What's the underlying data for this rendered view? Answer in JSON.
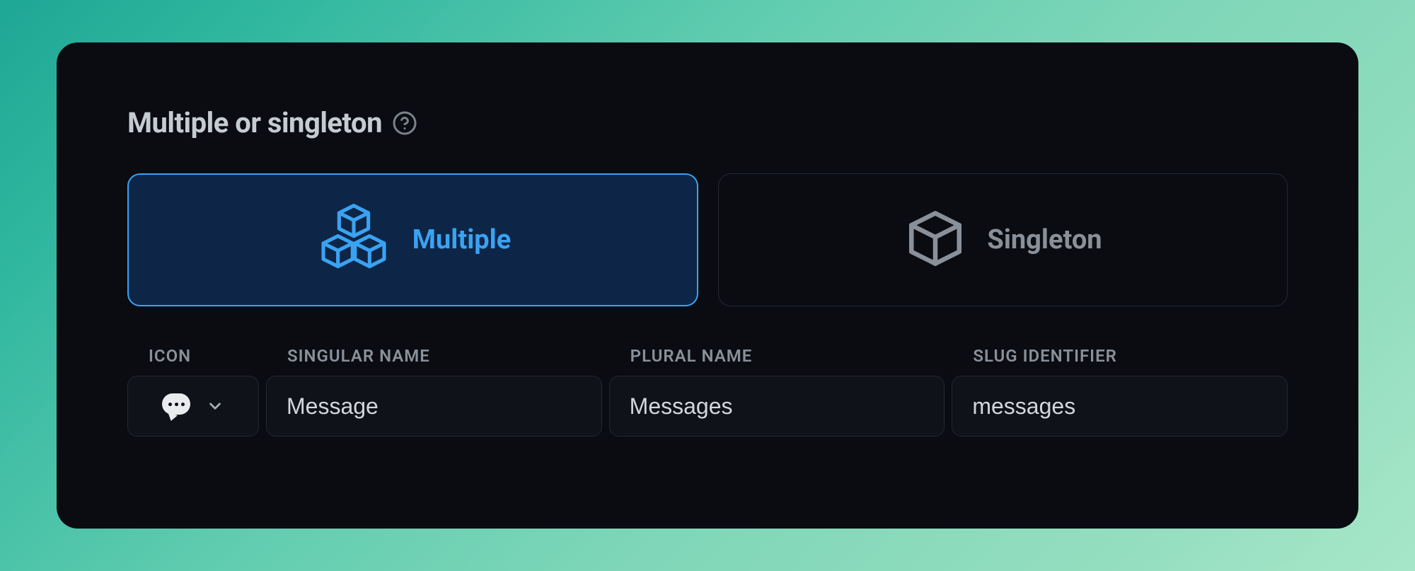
{
  "section": {
    "title": "Multiple or singleton"
  },
  "options": {
    "multiple": {
      "label": "Multiple",
      "selected": true
    },
    "singleton": {
      "label": "Singleton",
      "selected": false
    }
  },
  "fields": {
    "icon": {
      "label": "ICON",
      "value": "speech-bubble"
    },
    "singular": {
      "label": "SINGULAR NAME",
      "value": "Message"
    },
    "plural": {
      "label": "PLURAL NAME",
      "value": "Messages"
    },
    "slug": {
      "label": "SLUG IDENTIFIER",
      "value": "messages"
    }
  }
}
